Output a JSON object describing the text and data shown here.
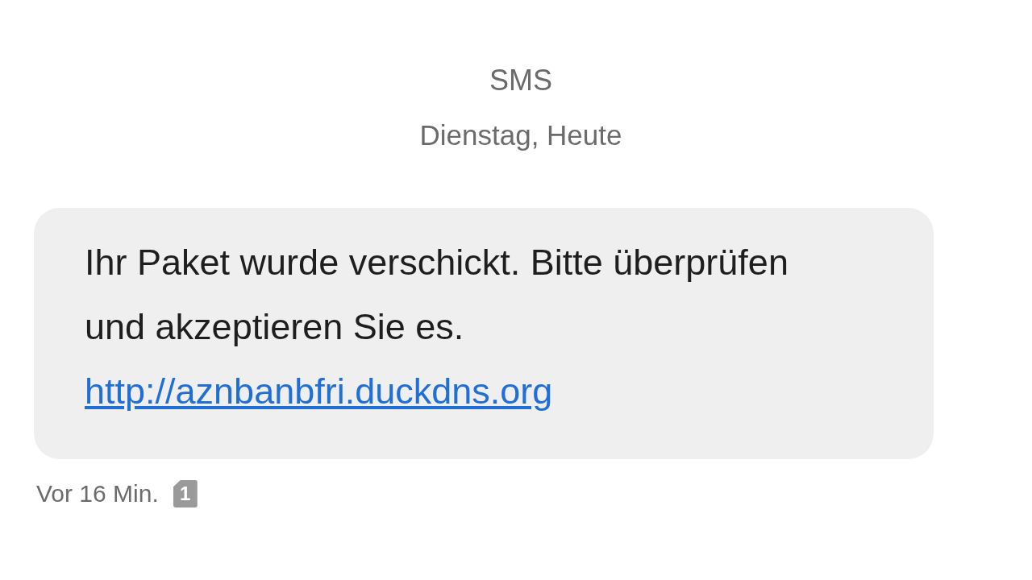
{
  "header": {
    "title": "SMS",
    "date": "Dienstag, Heute"
  },
  "message": {
    "text": "Ihr Paket wurde verschickt. Bitte überprüfen und akzeptieren Sie es.",
    "link": "http://aznbanbfri.duckdns.org",
    "time": "Vor 16 Min.",
    "sim_slot": "1"
  }
}
